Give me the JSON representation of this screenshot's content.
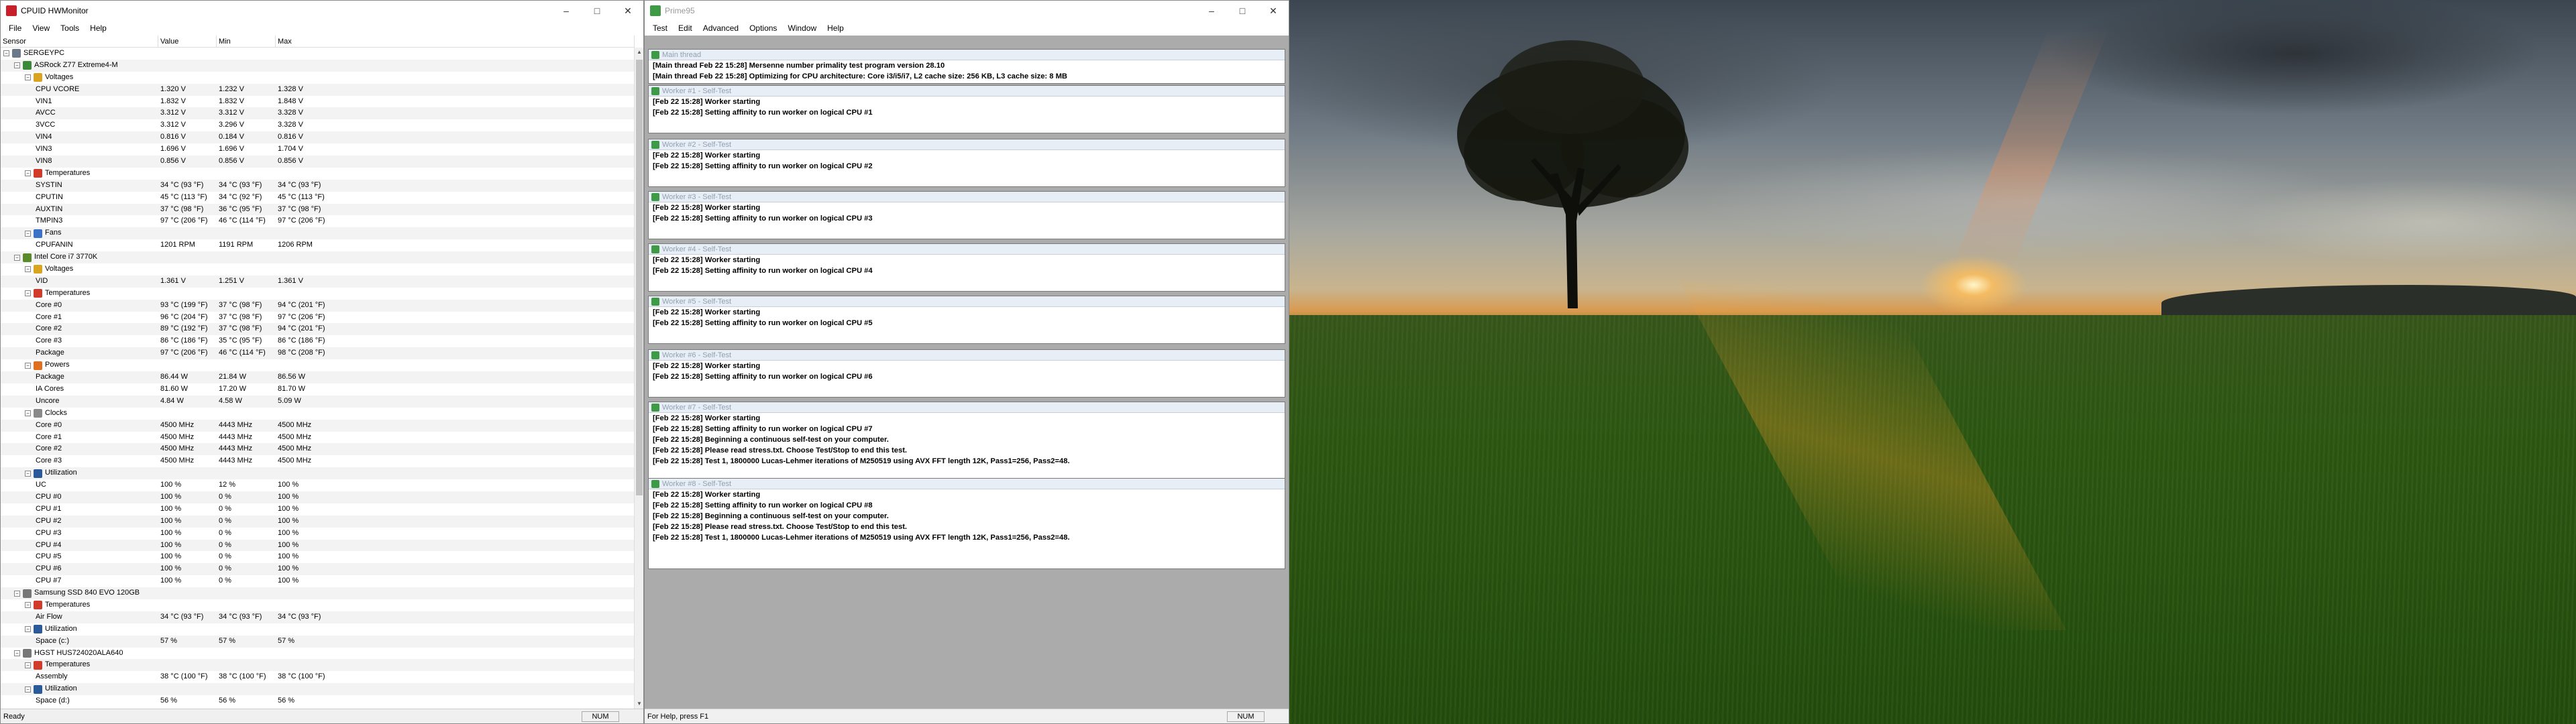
{
  "hwmonitor": {
    "title": "CPUID HWMonitor",
    "menu": [
      "File",
      "View",
      "Tools",
      "Help"
    ],
    "columns": [
      "Sensor",
      "Value",
      "Min",
      "Max"
    ],
    "status": "Ready",
    "num": "NUM",
    "rows": [
      {
        "level": 0,
        "label": "SERGEYPC",
        "icon": "computer-icon"
      },
      {
        "level": 1,
        "label": "ASRock Z77 Extreme4-M",
        "icon": "motherboard-icon"
      },
      {
        "level": 2,
        "label": "Voltages",
        "icon": "voltage-icon"
      },
      {
        "level": 3,
        "label": "CPU VCORE",
        "v": "1.320 V",
        "min": "1.232 V",
        "max": "1.328 V"
      },
      {
        "level": 3,
        "label": "VIN1",
        "v": "1.832 V",
        "min": "1.832 V",
        "max": "1.848 V"
      },
      {
        "level": 3,
        "label": "AVCC",
        "v": "3.312 V",
        "min": "3.312 V",
        "max": "3.328 V"
      },
      {
        "level": 3,
        "label": "3VCC",
        "v": "3.312 V",
        "min": "3.296 V",
        "max": "3.328 V"
      },
      {
        "level": 3,
        "label": "VIN4",
        "v": "0.816 V",
        "min": "0.184 V",
        "max": "0.816 V"
      },
      {
        "level": 3,
        "label": "VIN3",
        "v": "1.696 V",
        "min": "1.696 V",
        "max": "1.704 V"
      },
      {
        "level": 3,
        "label": "VIN8",
        "v": "0.856 V",
        "min": "0.856 V",
        "max": "0.856 V"
      },
      {
        "level": 2,
        "label": "Temperatures",
        "icon": "temperature-icon"
      },
      {
        "level": 3,
        "label": "SYSTIN",
        "v": "34 °C  (93 °F)",
        "min": "34 °C  (93 °F)",
        "max": "34 °C  (93 °F)"
      },
      {
        "level": 3,
        "label": "CPUTIN",
        "v": "45 °C  (113 °F)",
        "min": "34 °C  (92 °F)",
        "max": "45 °C  (113 °F)"
      },
      {
        "level": 3,
        "label": "AUXTIN",
        "v": "37 °C  (98 °F)",
        "min": "36 °C  (95 °F)",
        "max": "37 °C  (98 °F)"
      },
      {
        "level": 3,
        "label": "TMPIN3",
        "v": "97 °C  (206 °F)",
        "min": "46 °C  (114 °F)",
        "max": "97 °C  (206 °F)"
      },
      {
        "level": 2,
        "label": "Fans",
        "icon": "fan-icon"
      },
      {
        "level": 3,
        "label": "CPUFANIN",
        "v": "1201 RPM",
        "min": "1191 RPM",
        "max": "1206 RPM"
      },
      {
        "level": 1,
        "label": "Intel Core i7 3770K",
        "icon": "cpu-icon"
      },
      {
        "level": 2,
        "label": "Voltages",
        "icon": "voltage-icon"
      },
      {
        "level": 3,
        "label": "VID",
        "v": "1.361 V",
        "min": "1.251 V",
        "max": "1.361 V"
      },
      {
        "level": 2,
        "label": "Temperatures",
        "icon": "temperature-icon"
      },
      {
        "level": 3,
        "label": "Core #0",
        "v": "93 °C  (199 °F)",
        "min": "37 °C  (98 °F)",
        "max": "94 °C  (201 °F)"
      },
      {
        "level": 3,
        "label": "Core #1",
        "v": "96 °C  (204 °F)",
        "min": "37 °C  (98 °F)",
        "max": "97 °C  (206 °F)"
      },
      {
        "level": 3,
        "label": "Core #2",
        "v": "89 °C  (192 °F)",
        "min": "37 °C  (98 °F)",
        "max": "94 °C  (201 °F)"
      },
      {
        "level": 3,
        "label": "Core #3",
        "v": "86 °C  (186 °F)",
        "min": "35 °C  (95 °F)",
        "max": "86 °C  (186 °F)"
      },
      {
        "level": 3,
        "label": "Package",
        "v": "97 °C  (206 °F)",
        "min": "46 °C  (114 °F)",
        "max": "98 °C  (208 °F)"
      },
      {
        "level": 2,
        "label": "Powers",
        "icon": "power-icon"
      },
      {
        "level": 3,
        "label": "Package",
        "v": "86.44 W",
        "min": "21.84 W",
        "max": "86.56 W"
      },
      {
        "level": 3,
        "label": "IA Cores",
        "v": "81.60 W",
        "min": "17.20 W",
        "max": "81.70 W"
      },
      {
        "level": 3,
        "label": "Uncore",
        "v": "4.84 W",
        "min": "4.58 W",
        "max": "5.09 W"
      },
      {
        "level": 2,
        "label": "Clocks",
        "icon": "clock-icon"
      },
      {
        "level": 3,
        "label": "Core #0",
        "v": "4500 MHz",
        "min": "4443 MHz",
        "max": "4500 MHz"
      },
      {
        "level": 3,
        "label": "Core #1",
        "v": "4500 MHz",
        "min": "4443 MHz",
        "max": "4500 MHz"
      },
      {
        "level": 3,
        "label": "Core #2",
        "v": "4500 MHz",
        "min": "4443 MHz",
        "max": "4500 MHz"
      },
      {
        "level": 3,
        "label": "Core #3",
        "v": "4500 MHz",
        "min": "4443 MHz",
        "max": "4500 MHz"
      },
      {
        "level": 2,
        "label": "Utilization",
        "icon": "utilization-icon"
      },
      {
        "level": 3,
        "label": "UC",
        "v": "100 %",
        "min": "12 %",
        "max": "100 %"
      },
      {
        "level": 3,
        "label": "CPU #0",
        "v": "100 %",
        "min": "0 %",
        "max": "100 %"
      },
      {
        "level": 3,
        "label": "CPU #1",
        "v": "100 %",
        "min": "0 %",
        "max": "100 %"
      },
      {
        "level": 3,
        "label": "CPU #2",
        "v": "100 %",
        "min": "0 %",
        "max": "100 %"
      },
      {
        "level": 3,
        "label": "CPU #3",
        "v": "100 %",
        "min": "0 %",
        "max": "100 %"
      },
      {
        "level": 3,
        "label": "CPU #4",
        "v": "100 %",
        "min": "0 %",
        "max": "100 %"
      },
      {
        "level": 3,
        "label": "CPU #5",
        "v": "100 %",
        "min": "0 %",
        "max": "100 %"
      },
      {
        "level": 3,
        "label": "CPU #6",
        "v": "100 %",
        "min": "0 %",
        "max": "100 %"
      },
      {
        "level": 3,
        "label": "CPU #7",
        "v": "100 %",
        "min": "0 %",
        "max": "100 %"
      },
      {
        "level": 1,
        "label": "Samsung SSD 840 EVO 120GB",
        "icon": "drive-icon"
      },
      {
        "level": 2,
        "label": "Temperatures",
        "icon": "temperature-icon"
      },
      {
        "level": 3,
        "label": "Air Flow",
        "v": "34 °C  (93 °F)",
        "min": "34 °C  (93 °F)",
        "max": "34 °C  (93 °F)"
      },
      {
        "level": 2,
        "label": "Utilization",
        "icon": "utilization-icon"
      },
      {
        "level": 3,
        "label": "Space (c:)",
        "v": "57 %",
        "min": "57 %",
        "max": "57 %"
      },
      {
        "level": 1,
        "label": "HGST HUS724020ALA640",
        "icon": "drive-icon"
      },
      {
        "level": 2,
        "label": "Temperatures",
        "icon": "temperature-icon"
      },
      {
        "level": 3,
        "label": "Assembly",
        "v": "38 °C  (100 °F)",
        "min": "38 °C  (100 °F)",
        "max": "38 °C  (100 °F)"
      },
      {
        "level": 2,
        "label": "Utilization",
        "icon": "utilization-icon"
      },
      {
        "level": 3,
        "label": "Space (d:)",
        "v": "56 %",
        "min": "56 %",
        "max": "56 %"
      }
    ]
  },
  "prime95": {
    "title": "Prime95",
    "menu": [
      "Test",
      "Edit",
      "Advanced",
      "Options",
      "Window",
      "Help"
    ],
    "status": "For Help, press F1",
    "num": "NUM",
    "windows": [
      {
        "title": "Main thread",
        "lines": [
          "[Main thread Feb 22 15:28] Mersenne number primality test program version 28.10",
          "[Main thread Feb 22 15:28] Optimizing for CPU architecture: Core i3/i5/i7, L2 cache size: 256 KB, L3 cache size: 8 MB"
        ]
      },
      {
        "title": "Worker #1 - Self-Test",
        "lines": [
          "[Feb 22 15:28] Worker starting",
          "[Feb 22 15:28] Setting affinity to run worker on logical CPU #1"
        ]
      },
      {
        "title": "Worker #2 - Self-Test",
        "lines": [
          "[Feb 22 15:28] Worker starting",
          "[Feb 22 15:28] Setting affinity to run worker on logical CPU #2"
        ]
      },
      {
        "title": "Worker #3 - Self-Test",
        "lines": [
          "[Feb 22 15:28] Worker starting",
          "[Feb 22 15:28] Setting affinity to run worker on logical CPU #3"
        ]
      },
      {
        "title": "Worker #4 - Self-Test",
        "lines": [
          "[Feb 22 15:28] Worker starting",
          "[Feb 22 15:28] Setting affinity to run worker on logical CPU #4"
        ]
      },
      {
        "title": "Worker #5 - Self-Test",
        "lines": [
          "[Feb 22 15:28] Worker starting",
          "[Feb 22 15:28] Setting affinity to run worker on logical CPU #5"
        ]
      },
      {
        "title": "Worker #6 - Self-Test",
        "lines": [
          "[Feb 22 15:28] Worker starting",
          "[Feb 22 15:28] Setting affinity to run worker on logical CPU #6"
        ]
      },
      {
        "title": "Worker #7 - Self-Test",
        "lines": [
          "[Feb 22 15:28] Worker starting",
          "[Feb 22 15:28] Setting affinity to run worker on logical CPU #7",
          "[Feb 22 15:28] Beginning a continuous self-test on your computer.",
          "[Feb 22 15:28] Please read stress.txt.  Choose Test/Stop to end this test.",
          "[Feb 22 15:28] Test 1, 1800000 Lucas-Lehmer iterations of M250519 using AVX FFT length 12K, Pass1=256, Pass2=48."
        ]
      },
      {
        "title": "Worker #8 - Self-Test",
        "lines": [
          "[Feb 22 15:28] Worker starting",
          "[Feb 22 15:28] Setting affinity to run worker on logical CPU #8",
          "[Feb 22 15:28] Beginning a continuous self-test on your computer.",
          "[Feb 22 15:28] Please read stress.txt.  Choose Test/Stop to end this test.",
          "[Feb 22 15:28] Test 1, 1800000 Lucas-Lehmer iterations of M250519 using AVX FFT length 12K, Pass1=256, Pass2=48."
        ]
      }
    ]
  }
}
